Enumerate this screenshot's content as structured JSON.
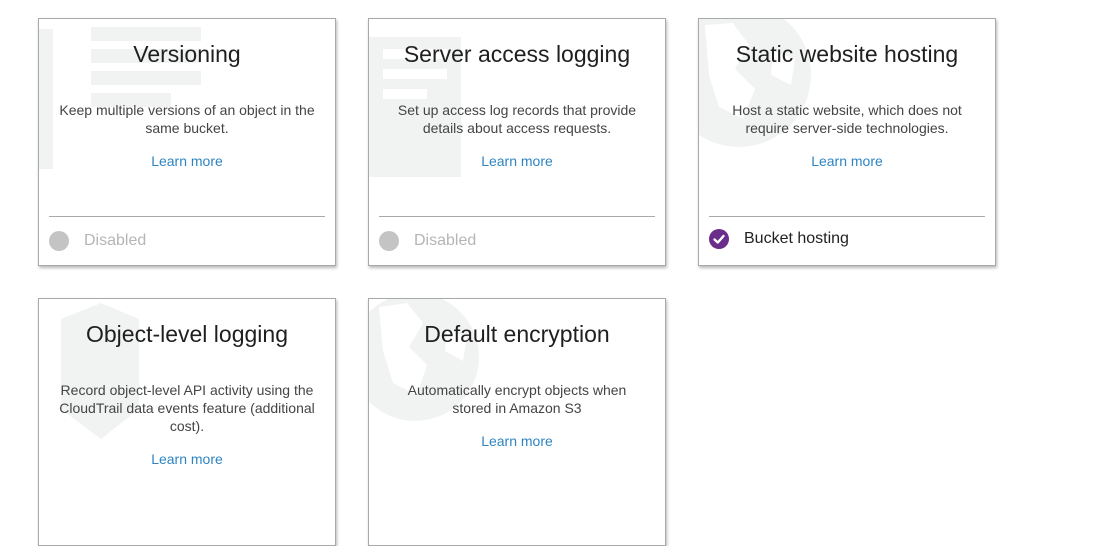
{
  "cards": [
    {
      "title": "Versioning",
      "description": "Keep multiple versions of an object in the same bucket.",
      "learn_more": "Learn more",
      "status": "Disabled",
      "icon": "versioning-watermark-icon"
    },
    {
      "title": "Server access logging",
      "description": "Set up access log records that provide details about access requests.",
      "learn_more": "Learn more",
      "status": "Disabled",
      "icon": "logging-watermark-icon"
    },
    {
      "title": "Static website hosting",
      "description": "Host a static website, which does not require server-side technologies.",
      "learn_more": "Learn more",
      "status": "Bucket hosting",
      "icon": "globe-watermark-icon"
    },
    {
      "title": "Object-level logging",
      "description": "Record object-level API activity using the CloudTrail data events feature (additional cost).",
      "learn_more": "Learn more",
      "icon": "shield-watermark-icon"
    },
    {
      "title": "Default encryption",
      "description": "Automatically encrypt objects when stored in Amazon S3",
      "learn_more": "Learn more",
      "icon": "globe-watermark-icon"
    }
  ],
  "colors": {
    "link": "#2e84c2",
    "enabled": "#6a2d8b",
    "disabled": "#c4c4c4",
    "watermark": "#f1f3f2"
  }
}
